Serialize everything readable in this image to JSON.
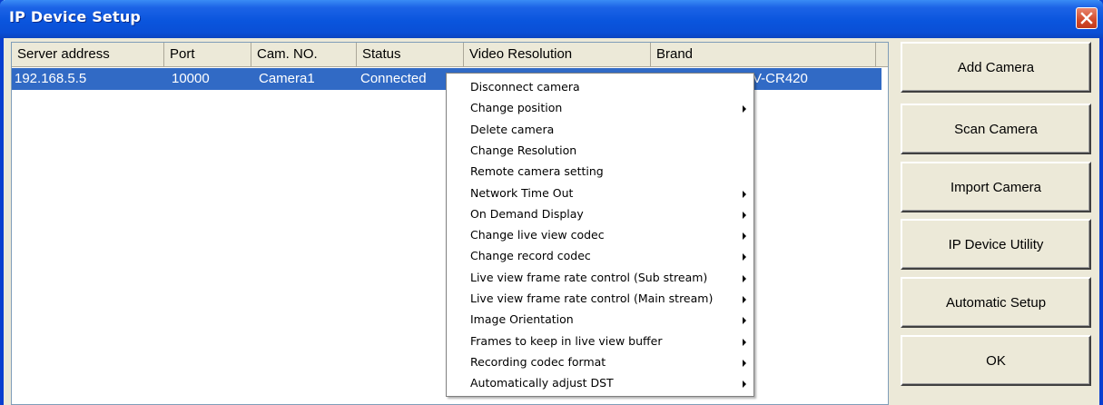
{
  "window": {
    "title": "IP Device Setup"
  },
  "table": {
    "columns": [
      "Server address",
      "Port",
      "Cam. NO.",
      "Status",
      "Video Resolution",
      "Brand"
    ],
    "rows": [
      {
        "server": "192.168.5.5",
        "port": "10000",
        "cam": "Camera1",
        "status": "Connected",
        "brand_partial": "V-CR420"
      }
    ]
  },
  "buttons": {
    "add_camera": "Add Camera",
    "scan_camera": "Scan Camera",
    "import_camera": "Import Camera",
    "ip_device_utility": "IP Device Utility",
    "automatic_setup": "Automatic Setup",
    "ok": "OK"
  },
  "context_menu": {
    "items": [
      {
        "label": "Disconnect camera",
        "submenu": false
      },
      {
        "label": "Change position",
        "submenu": true
      },
      {
        "label": "Delete camera",
        "submenu": false
      },
      {
        "label": "Change Resolution",
        "submenu": false
      },
      {
        "label": "Remote camera setting",
        "submenu": false
      },
      {
        "label": "Network Time Out",
        "submenu": true
      },
      {
        "label": "On Demand Display",
        "submenu": true
      },
      {
        "label": "Change live view codec",
        "submenu": true
      },
      {
        "label": "Change record codec",
        "submenu": true
      },
      {
        "label": "Live view frame rate control (Sub stream)",
        "submenu": true
      },
      {
        "label": "Live view frame rate control (Main stream)",
        "submenu": true
      },
      {
        "label": "Image Orientation",
        "submenu": true
      },
      {
        "label": "Frames to keep in live view buffer",
        "submenu": true
      },
      {
        "label": "Recording codec format",
        "submenu": true
      },
      {
        "label": "Automatically adjust DST",
        "submenu": true
      }
    ]
  }
}
